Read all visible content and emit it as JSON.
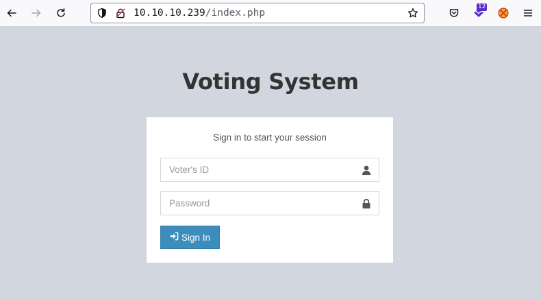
{
  "browser": {
    "url_host": "10.10.10.239",
    "url_path": "/index.php",
    "extension_badge": "12",
    "icons": [
      "back-icon",
      "forward-icon",
      "reload-icon",
      "shield-icon",
      "lock-icon",
      "star-icon",
      "pocket-icon",
      "extension-icon",
      "addon-icon",
      "menu-icon"
    ]
  },
  "page": {
    "title": "Voting System",
    "login_message": "Sign in to start your session",
    "voter_id_placeholder": "Voter's ID",
    "password_placeholder": "Password",
    "signin_label": "Sign In"
  },
  "colors": {
    "background": "#d2d6de",
    "button": "#3c8dbc",
    "title": "#333333"
  }
}
